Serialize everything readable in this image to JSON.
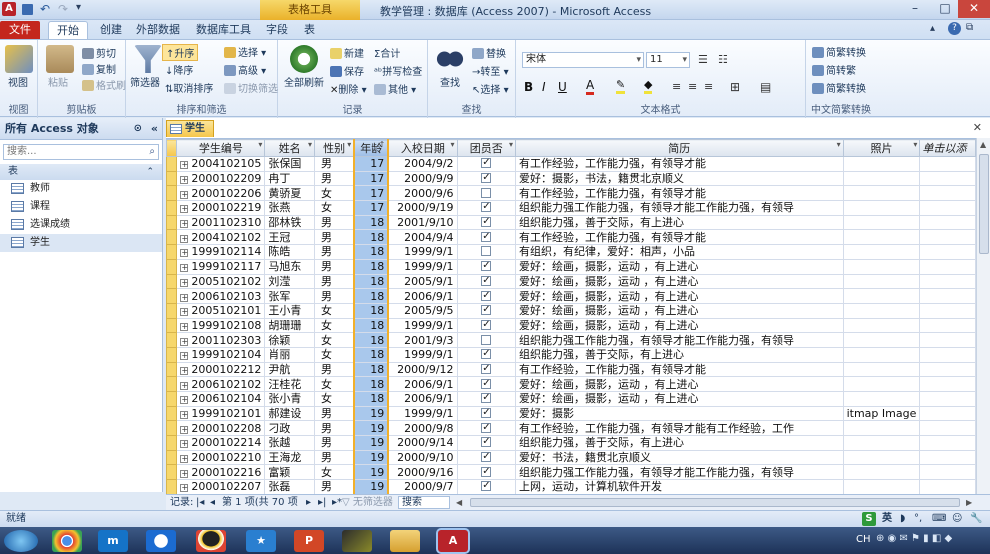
{
  "window": {
    "title": "教学管理 : 数据库 (Access 2007)  -  Microsoft Access",
    "context_tab": "表格工具"
  },
  "tabs": {
    "file": "文件",
    "home": "开始",
    "create": "创建",
    "external": "外部数据",
    "dbtools": "数据库工具",
    "fields": "字段",
    "table": "表"
  },
  "ribbon": {
    "view": "视图",
    "paste": "粘贴",
    "cut": "剪切",
    "copy": "复制",
    "format_painter": "格式刷",
    "clipboard": "剪贴板",
    "filter": "筛选器",
    "asc": "升序",
    "desc": "降序",
    "clear_sort": "取消排序",
    "selection": "选择",
    "advanced": "高级",
    "toggle_filter": "切换筛选",
    "sort_filter": "排序和筛选",
    "refresh_all": "全部刷新",
    "new": "新建",
    "save": "保存",
    "delete": "删除",
    "totals": "合计",
    "spelling": "拼写检查",
    "more": "其他",
    "records": "记录",
    "find": "查找",
    "replace": "替换",
    "goto": "转至",
    "select": "选择",
    "find_group": "查找",
    "font": "宋体",
    "font_size": "11",
    "text_format": "文本格式",
    "to_trad": "简繁转换",
    "to_simp": "简转繁",
    "trad_simp": "简繁转换",
    "cn_group": "中文简繁转换"
  },
  "nav": {
    "header": "所有 Access 对象",
    "search_placeholder": "搜索...",
    "section": "表",
    "items": [
      "教师",
      "课程",
      "选课成绩",
      "学生"
    ]
  },
  "doc": {
    "tab": "学生"
  },
  "columns": [
    "学生编号",
    "姓名",
    "性别",
    "年龄",
    "入校日期",
    "团员否",
    "简历",
    "照片",
    "单击以添"
  ],
  "rows": [
    [
      "2004102105",
      "张保国",
      "男",
      "17",
      "2004/9/2",
      true,
      "有工作经验，工作能力强，有领导才能",
      ""
    ],
    [
      "2000102209",
      "冉丁",
      "男",
      "17",
      "2000/9/9",
      true,
      "爱好：摄影，书法，籍贯北京顺义",
      ""
    ],
    [
      "2000102206",
      "黄骄夏",
      "女",
      "17",
      "2000/9/6",
      false,
      "有工作经验，工作能力强，有领导才能",
      ""
    ],
    [
      "2000102219",
      "张燕",
      "女",
      "17",
      "2000/9/19",
      true,
      "组织能力强工作能力强，有领导才能工作能力强，有领导",
      ""
    ],
    [
      "2001102310",
      "邵林铁",
      "男",
      "18",
      "2001/9/10",
      true,
      "组织能力强，善于交际，有上进心",
      ""
    ],
    [
      "2004102102",
      "王冠",
      "男",
      "18",
      "2004/9/4",
      true,
      "有工作经验，工作能力强，有领导才能",
      ""
    ],
    [
      "1999102114",
      "陈皓",
      "男",
      "18",
      "1999/9/1",
      false,
      "有组织，有纪律，爱好：相声，小品",
      ""
    ],
    [
      "1999102117",
      "马旭东",
      "男",
      "18",
      "1999/9/1",
      true,
      "爱好：绘画，摄影，运动 ，有上进心",
      ""
    ],
    [
      "2005102102",
      "刘滢",
      "男",
      "18",
      "2005/9/1",
      true,
      "爱好：绘画，摄影，运动 ，有上进心",
      ""
    ],
    [
      "2006102103",
      "张军",
      "男",
      "18",
      "2006/9/1",
      true,
      "爱好：绘画，摄影，运动 ，有上进心",
      ""
    ],
    [
      "2005102101",
      "王小青",
      "女",
      "18",
      "2005/9/5",
      true,
      "爱好：绘画，摄影，运动 ，有上进心",
      ""
    ],
    [
      "1999102108",
      "胡珊珊",
      "女",
      "18",
      "1999/9/1",
      true,
      "爱好：绘画，摄影，运动 ，有上进心",
      ""
    ],
    [
      "2001102303",
      "徐颖",
      "女",
      "18",
      "2001/9/3",
      false,
      "组织能力强工作能力强，有领导才能工作能力强，有领导",
      ""
    ],
    [
      "1999102104",
      "肖丽",
      "女",
      "18",
      "1999/9/1",
      true,
      "组织能力强，善于交际，有上进心",
      ""
    ],
    [
      "2000102212",
      "尹航",
      "男",
      "18",
      "2000/9/12",
      true,
      "有工作经验，工作能力强，有领导才能",
      ""
    ],
    [
      "2006102102",
      "汪桂花",
      "女",
      "18",
      "2006/9/1",
      true,
      "爱好：绘画，摄影，运动 ，有上进心",
      ""
    ],
    [
      "2006102104",
      "张小青",
      "女",
      "18",
      "2006/9/1",
      true,
      "爱好：绘画，摄影，运动 ，有上进心",
      ""
    ],
    [
      "1999102101",
      "郝建设",
      "男",
      "19",
      "1999/9/1",
      true,
      "爱好：摄影",
      "itmap Image"
    ],
    [
      "2000102208",
      "刁政",
      "男",
      "19",
      "2000/9/8",
      true,
      "有工作经验，工作能力强，有领导才能有工作经验，工作",
      ""
    ],
    [
      "2000102214",
      "张越",
      "男",
      "19",
      "2000/9/14",
      true,
      "组织能力强，善于交际，有上进心",
      ""
    ],
    [
      "2000102210",
      "王海龙",
      "男",
      "19",
      "2000/9/10",
      true,
      "爱好：书法，籍贯北京顺义",
      ""
    ],
    [
      "2000102216",
      "富颖",
      "女",
      "19",
      "2000/9/16",
      true,
      "组织能力强工作能力强，有领导才能工作能力强，有领导",
      ""
    ],
    [
      "2000102207",
      "张磊",
      "男",
      "19",
      "2000/9/7",
      true,
      "上网，运动，计算机软件开发",
      ""
    ]
  ],
  "record_nav": {
    "label": "记录:",
    "current": "第 1 项(共 70 项",
    "no_filter": "无筛选器",
    "search": "搜索"
  },
  "status": {
    "text": "就绪",
    "ime": "英",
    "lang": "CH"
  },
  "colors": {
    "file_tab": "#c4261d",
    "context_tab": "#eab12a",
    "selected_column": "#a9c8ec"
  }
}
